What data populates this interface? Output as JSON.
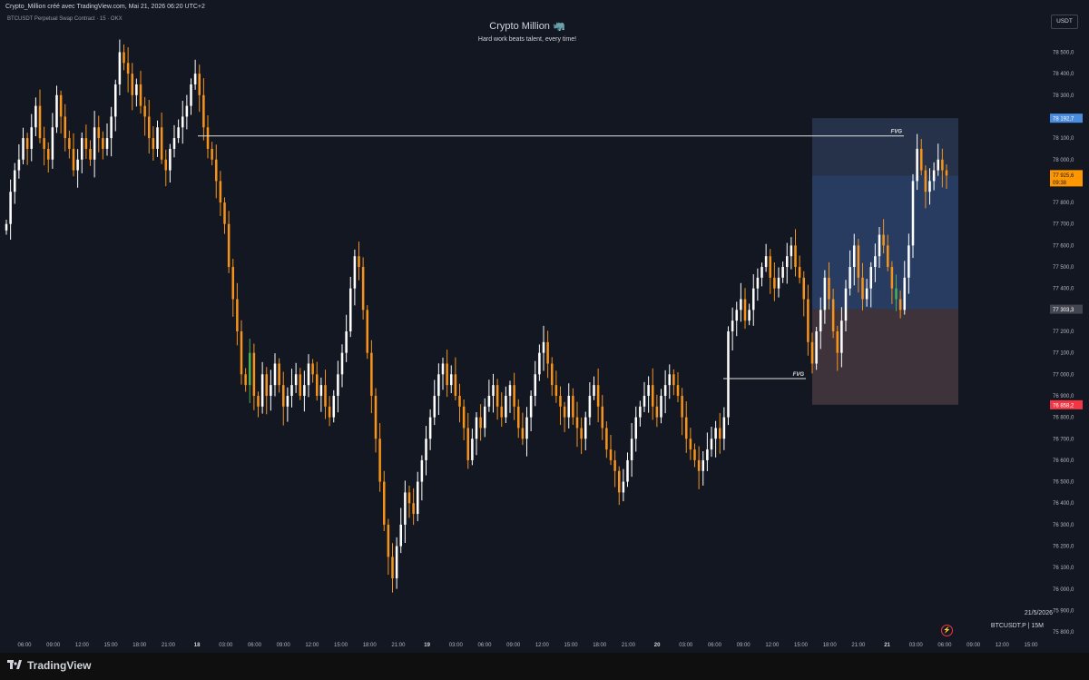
{
  "header": {
    "attribution": "Crypto_Million créé avec TradingView.com, Mai 21, 2026 06:20 UTC+2",
    "symbol_line": "BTCUSDT Perpetual Swap Contract · 15 · OKX",
    "title": "Crypto Million 🦏",
    "subtitle": "Hard work beats talent, every time!",
    "currency": "USDT"
  },
  "overlay": {
    "date": "21/5/2026",
    "symbol_interval": "BTCUSDT.P | 15M"
  },
  "footer": {
    "brand": "TradingView"
  },
  "colors": {
    "background": "#131722",
    "bull_candle": "#ffffff",
    "bear_candle": "#f7931a",
    "green_candle": "#4caf50",
    "fvg_upper": "#2a3a55",
    "fvg_lower": "#3a3e54",
    "fvg_red": "#4a3b42",
    "current_price": "#ff9800",
    "upper_tag": "#4a8de0",
    "lower_tag": "#f23645",
    "mid_tag": "#434651"
  },
  "chart_data": {
    "type": "candlestick",
    "title": "Crypto Million 🦏",
    "ylim": [
      75750,
      78650
    ],
    "y_ticks": [
      75800,
      75900,
      76000,
      76100,
      76200,
      76300,
      76400,
      76500,
      76600,
      76700,
      76800,
      76900,
      77000,
      77100,
      77200,
      77300,
      77400,
      77500,
      77600,
      77700,
      77800,
      77900,
      78000,
      78100,
      78200,
      78300,
      78400,
      78500
    ],
    "y_tick_labels": [
      "75 800,0",
      "75 900,0",
      "76 000,0",
      "76 100,0",
      "76 200,0",
      "76 300,0",
      "76 400,0",
      "76 500,0",
      "76 600,0",
      "76 700,0",
      "76 800,0",
      "76 900,0",
      "77 000,0",
      "77 100,0",
      "77 200,0",
      "77 300,0",
      "77 400,0",
      "77 500,0",
      "77 600,0",
      "77 700,0",
      "77 800,0",
      "77 900,0",
      "78 000,0",
      "78 100,0",
      "78 200,0",
      "78 300,0",
      "78 400,0",
      "78 500,0"
    ],
    "x_tick_labels": [
      "06:00",
      "09:00",
      "12:00",
      "15:00",
      "18:00",
      "21:00",
      "18",
      "03:00",
      "06:00",
      "09:00",
      "12:00",
      "15:00",
      "18:00",
      "21:00",
      "19",
      "03:00",
      "06:00",
      "09:00",
      "12:00",
      "15:00",
      "18:00",
      "21:00",
      "20",
      "03:00",
      "06:00",
      "09:00",
      "12:00",
      "15:00",
      "18:00",
      "21:00",
      "21",
      "03:00",
      "06:00",
      "09:00",
      "12:00",
      "15:00"
    ],
    "current_price": {
      "value": 77925.6,
      "label": "77 925,6",
      "countdown": "09:38"
    },
    "price_tags": [
      {
        "value": 78192.7,
        "label": "78 192,7",
        "kind": "upper"
      },
      {
        "value": 77303.3,
        "label": "77 303,3",
        "kind": "mid"
      },
      {
        "value": 76858.2,
        "label": "76 858,2",
        "kind": "lower"
      }
    ],
    "fvg_lines": [
      {
        "label": "FVG",
        "price": 78110
      },
      {
        "label": "FVG",
        "price": 76980
      }
    ],
    "zones": [
      {
        "name": "upper",
        "top": 78192.7,
        "bottom": 77925.6
      },
      {
        "name": "middle",
        "top": 77925.6,
        "bottom": 77303.3
      },
      {
        "name": "lower",
        "top": 77303.3,
        "bottom": 76858.2
      }
    ],
    "closes": [
      77700,
      77850,
      77950,
      78000,
      78100,
      78050,
      78150,
      78250,
      78100,
      78050,
      78000,
      78150,
      78300,
      78200,
      78100,
      78050,
      77950,
      78000,
      78100,
      78050,
      78000,
      78150,
      78100,
      78050,
      78100,
      78200,
      78350,
      78500,
      78450,
      78400,
      78300,
      78350,
      78250,
      78200,
      78100,
      78050,
      78150,
      78000,
      77950,
      78050,
      78100,
      78150,
      78200,
      78250,
      78350,
      78400,
      78300,
      78150,
      78050,
      78000,
      77900,
      77800,
      77700,
      77500,
      77350,
      77200,
      77000,
      76950,
      77100,
      76900,
      76850,
      77000,
      76900,
      76950,
      77050,
      76950,
      76850,
      76900,
      76950,
      77000,
      76900,
      76950,
      77050,
      77000,
      76900,
      76950,
      76850,
      76800,
      76900,
      77000,
      77100,
      77200,
      77400,
      77550,
      77500,
      77300,
      77100,
      76900,
      76700,
      76500,
      76300,
      76150,
      76050,
      76200,
      76300,
      76450,
      76400,
      76350,
      76500,
      76600,
      76700,
      76800,
      76900,
      77000,
      77050,
      76950,
      77000,
      76900,
      76850,
      76750,
      76600,
      76700,
      76800,
      76750,
      76850,
      76900,
      76950,
      76850,
      76800,
      76900,
      76950,
      76850,
      76750,
      76700,
      76800,
      76900,
      77000,
      77100,
      77150,
      77050,
      76950,
      76900,
      76850,
      76800,
      76900,
      76800,
      76750,
      76700,
      76800,
      76900,
      76950,
      76850,
      76750,
      76650,
      76600,
      76550,
      76450,
      76500,
      76600,
      76700,
      76800,
      76850,
      76900,
      76950,
      76850,
      76800,
      76900,
      76950,
      77000,
      76950,
      76900,
      76800,
      76700,
      76650,
      76600,
      76550,
      76600,
      76650,
      76700,
      76750,
      76700,
      76800,
      77200,
      77250,
      77300,
      77350,
      77250,
      77300,
      77400,
      77450,
      77500,
      77550,
      77450,
      77400,
      77450,
      77500,
      77550,
      77600,
      77500,
      77450,
      77350,
      77150,
      77050,
      77200,
      77300,
      77450,
      77350,
      77200,
      77100,
      77250,
      77400,
      77500,
      77600,
      77450,
      77350,
      77400,
      77500,
      77550,
      77650,
      77600,
      77500,
      77400,
      77350,
      77300,
      77450,
      77600,
      77900,
      78050,
      77950,
      77850,
      77900,
      77950,
      78000,
      77950,
      77925.6
    ]
  }
}
